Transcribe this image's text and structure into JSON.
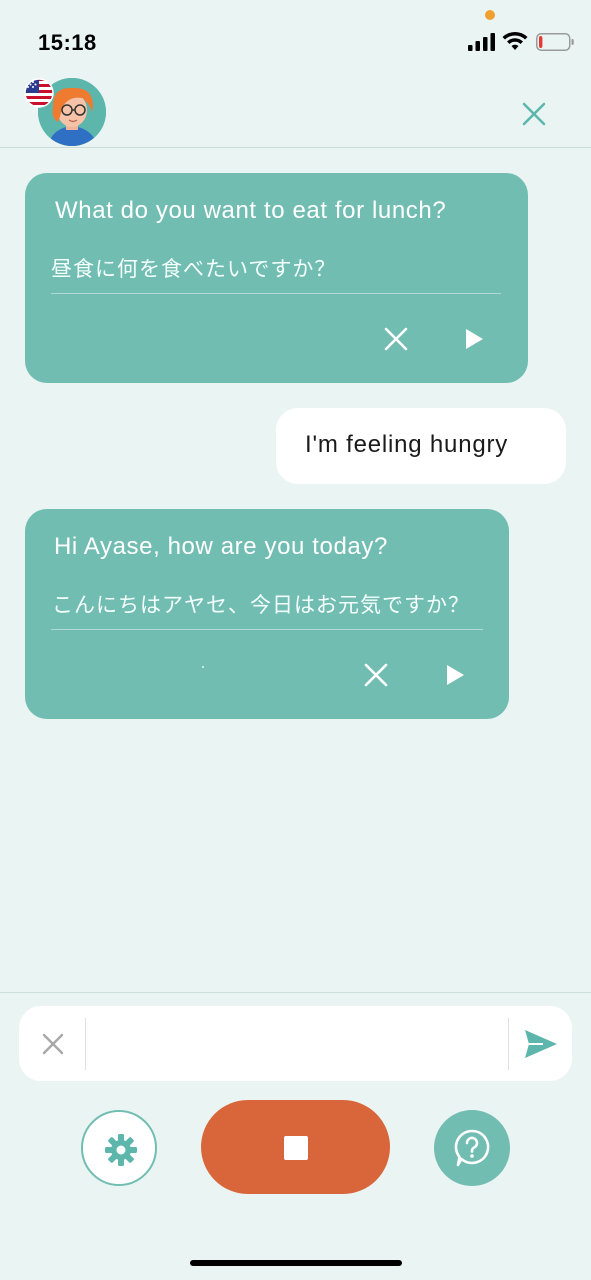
{
  "status_bar": {
    "time": "15:18",
    "battery_level": 0.12,
    "battery_color": "#e53935"
  },
  "header": {
    "avatar": "tutor-avatar",
    "language_flag": "us-flag-icon",
    "close": "close-icon"
  },
  "messages": [
    {
      "role": "bot",
      "english": "What do you want to eat for lunch?",
      "japanese": "昼食に何を食べたいですか？",
      "actions": [
        "close-icon",
        "play-icon"
      ]
    },
    {
      "role": "user",
      "text": "I'm feeling hungry"
    },
    {
      "role": "bot",
      "english": "Hi Ayase, how are you today?",
      "japanese": "こんにちはアヤセ、今日はお元気ですか？",
      "actions": [
        "close-icon",
        "play-icon"
      ]
    }
  ],
  "input": {
    "value": "",
    "placeholder": ""
  },
  "controls": {
    "settings": "gear-icon",
    "record": "stop-icon",
    "help": "question-bubble-icon"
  },
  "colors": {
    "background": "#eaf5f3",
    "bot_bubble": "#72bdb2",
    "user_bubble": "#ffffff",
    "record_button": "#d9663a",
    "accent": "#5db6ac"
  }
}
